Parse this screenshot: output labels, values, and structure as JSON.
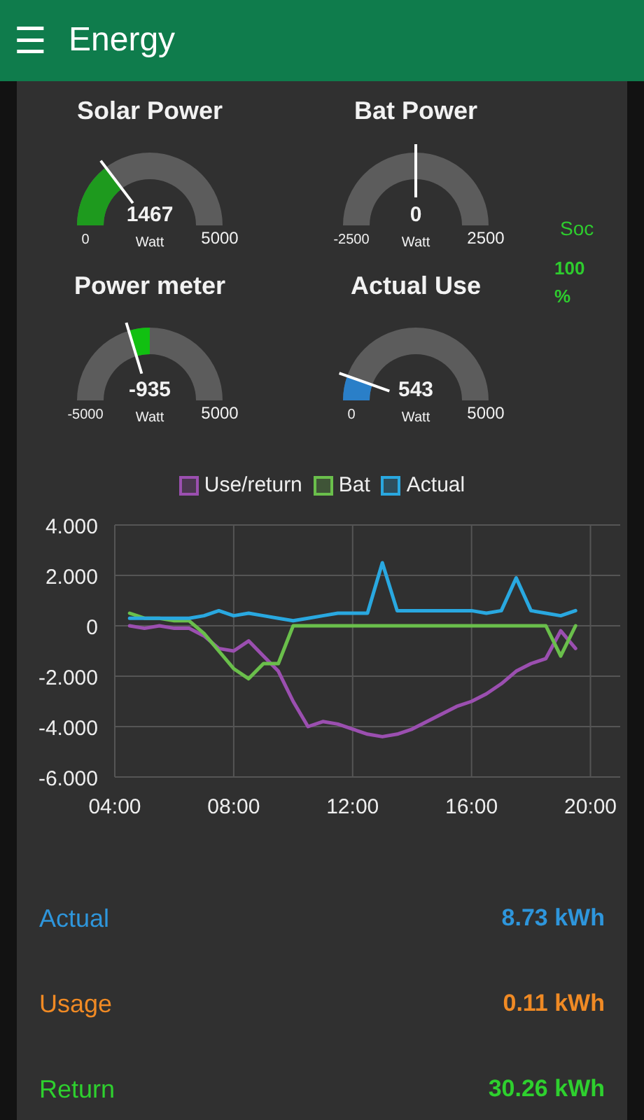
{
  "app_bar": {
    "menu_icon": "☰",
    "title": "Energy"
  },
  "gauges": [
    {
      "title": "Solar Power",
      "value": "1467",
      "unit": "Watt",
      "min": "0",
      "max": "5000",
      "kind": "from_min",
      "color": "#1e9a1e"
    },
    {
      "title": "Bat Power",
      "value": "0",
      "unit": "Watt",
      "min": "-2500",
      "max": "2500",
      "kind": "centered"
    },
    {
      "title": "Power meter",
      "value": "-935",
      "unit": "Watt",
      "min": "-5000",
      "max": "5000",
      "kind": "centered",
      "color": "#11c011"
    },
    {
      "title": "Actual Use",
      "value": "543",
      "unit": "Watt",
      "min": "0",
      "max": "5000",
      "kind": "from_min",
      "color": "#2a7fc8"
    }
  ],
  "soc": {
    "label": "Soc",
    "value": "100",
    "unit": "%"
  },
  "chart": {
    "chart_data": {
      "type": "line",
      "x": [
        4.5,
        5,
        5.5,
        6,
        6.5,
        7,
        7.5,
        8,
        8.5,
        9,
        9.5,
        10,
        10.5,
        11,
        11.5,
        12,
        12.5,
        13,
        13.5,
        14,
        14.5,
        15,
        15.5,
        16,
        16.5,
        17,
        17.5,
        18,
        18.5,
        19,
        19.5
      ],
      "series": [
        {
          "name": "Use/return",
          "color": "#9b4fb0",
          "values": [
            0,
            -0.1,
            0,
            -0.1,
            -0.1,
            -0.4,
            -0.9,
            -1,
            -0.6,
            -1.2,
            -1.8,
            -3,
            -4,
            -3.8,
            -3.9,
            -4.1,
            -4.3,
            -4.4,
            -4.3,
            -4.1,
            -3.8,
            -3.5,
            -3.2,
            -3,
            -2.7,
            -2.3,
            -1.8,
            -1.5,
            -1.3,
            -0.2,
            -0.9
          ]
        },
        {
          "name": "Bat",
          "color": "#6abf4b",
          "values": [
            0.5,
            0.3,
            0.3,
            0.2,
            0.2,
            -0.3,
            -1,
            -1.7,
            -2.1,
            -1.5,
            -1.5,
            0,
            0,
            0,
            0,
            0,
            0,
            0,
            0,
            0,
            0,
            0,
            0,
            0,
            0,
            0,
            0,
            0,
            0,
            -1.2,
            0
          ]
        },
        {
          "name": "Actual",
          "color": "#29a8e0",
          "values": [
            0.3,
            0.3,
            0.3,
            0.3,
            0.3,
            0.4,
            0.6,
            0.4,
            0.5,
            0.4,
            0.3,
            0.2,
            0.3,
            0.4,
            0.5,
            0.5,
            0.5,
            2.5,
            0.6,
            0.6,
            0.6,
            0.6,
            0.6,
            0.6,
            0.5,
            0.6,
            1.9,
            0.6,
            0.5,
            0.4,
            0.6
          ]
        }
      ],
      "grid": true,
      "legend": "top",
      "xlim": [
        4,
        21
      ],
      "ylim": [
        -6,
        4
      ],
      "xticks": [
        {
          "value": 4,
          "label": "04:00"
        },
        {
          "value": 8,
          "label": "08:00"
        },
        {
          "value": 12,
          "label": "12:00"
        },
        {
          "value": 16,
          "label": "16:00"
        },
        {
          "value": 20,
          "label": "20:00"
        }
      ],
      "yticks": [
        {
          "value": 4,
          "label": "4.000"
        },
        {
          "value": 2,
          "label": "2.000"
        },
        {
          "value": 0,
          "label": "0"
        },
        {
          "value": -2,
          "label": "-2.000"
        },
        {
          "value": -4,
          "label": "-4.000"
        },
        {
          "value": -6,
          "label": "-6.000"
        }
      ]
    }
  },
  "totals": [
    {
      "label": "Actual",
      "value": "8.73 kWh",
      "color": "#2e96dc"
    },
    {
      "label": "Usage",
      "value": "0.11 kWh",
      "color": "#f08a24"
    },
    {
      "label": "Return",
      "value": "30.26 kWh",
      "color": "#2ed02e"
    }
  ]
}
